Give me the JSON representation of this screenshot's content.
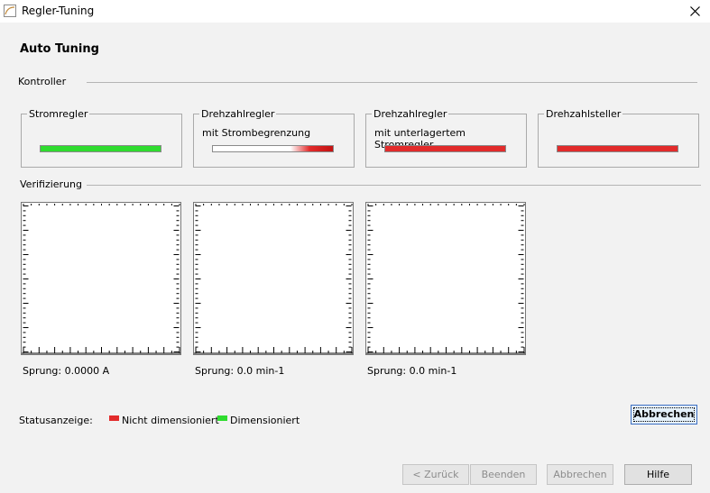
{
  "window": {
    "title": "Regler-Tuning",
    "close_icon": "close-icon"
  },
  "page": {
    "title": "Auto Tuning"
  },
  "colors": {
    "green": "#2fdc2f",
    "red": "#e22b2b",
    "dark_red": "#c41212",
    "background": "#f2f2f2"
  },
  "controllers": {
    "label": "Kontroller",
    "groups": [
      {
        "label": "Stromregler",
        "sub": "",
        "status": "Dimensioniert",
        "color": "#2fdc2f",
        "fill": 1.0
      },
      {
        "label": "Drehzahlregler",
        "sub": "mit Strombegrenzung",
        "status": "Nicht dimensioniert",
        "color": "#e22b2b",
        "fill": 0.35
      },
      {
        "label": "Drehzahlregler",
        "sub": "mit unterlagertem Stromregler",
        "status": "Nicht dimensioniert",
        "color": "#e22b2b",
        "fill": 1.0
      },
      {
        "label": "Drehzahlsteller",
        "sub": "",
        "status": "Nicht dimensioniert",
        "color": "#e22b2b",
        "fill": 1.0
      }
    ]
  },
  "verification": {
    "label": "Verifizierung",
    "plots": [
      {
        "caption": "Sprung: 0.0000 A"
      },
      {
        "caption": "Sprung: 0.0 min-1"
      },
      {
        "caption": "Sprung: 0.0 min-1"
      }
    ]
  },
  "status": {
    "label": "Statusanzeige:",
    "legend": [
      {
        "text": "Nicht dimensioniert",
        "color": "#e22b2b"
      },
      {
        "text": "Dimensioniert",
        "color": "#2fdc2f"
      }
    ]
  },
  "buttons": {
    "abort_main": "Abbrechen",
    "back": "< Zurück",
    "finish": "Beenden",
    "cancel": "Abbrechen",
    "help": "Hilfe"
  }
}
